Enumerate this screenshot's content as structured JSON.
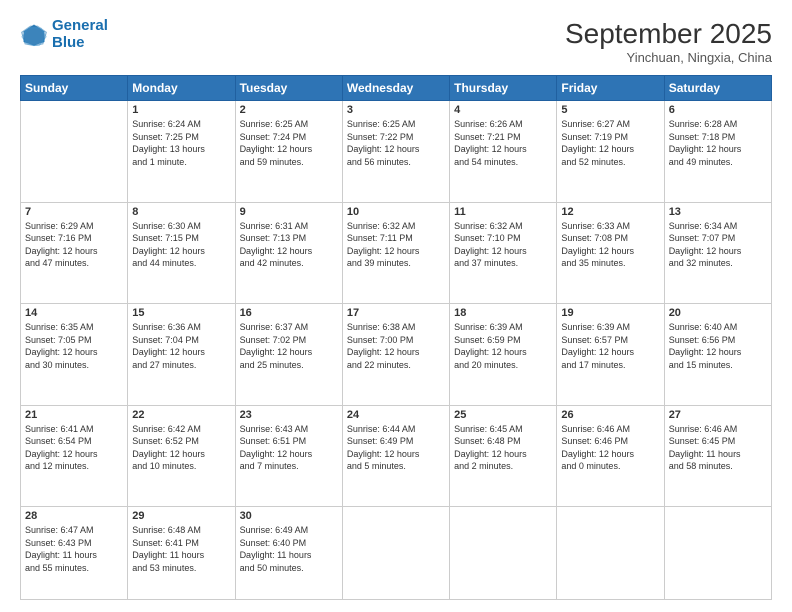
{
  "logo": {
    "line1": "General",
    "line2": "Blue"
  },
  "header": {
    "month_year": "September 2025",
    "location": "Yinchuan, Ningxia, China"
  },
  "weekdays": [
    "Sunday",
    "Monday",
    "Tuesday",
    "Wednesday",
    "Thursday",
    "Friday",
    "Saturday"
  ],
  "weeks": [
    [
      {
        "day": "",
        "info": ""
      },
      {
        "day": "1",
        "info": "Sunrise: 6:24 AM\nSunset: 7:25 PM\nDaylight: 13 hours\nand 1 minute."
      },
      {
        "day": "2",
        "info": "Sunrise: 6:25 AM\nSunset: 7:24 PM\nDaylight: 12 hours\nand 59 minutes."
      },
      {
        "day": "3",
        "info": "Sunrise: 6:25 AM\nSunset: 7:22 PM\nDaylight: 12 hours\nand 56 minutes."
      },
      {
        "day": "4",
        "info": "Sunrise: 6:26 AM\nSunset: 7:21 PM\nDaylight: 12 hours\nand 54 minutes."
      },
      {
        "day": "5",
        "info": "Sunrise: 6:27 AM\nSunset: 7:19 PM\nDaylight: 12 hours\nand 52 minutes."
      },
      {
        "day": "6",
        "info": "Sunrise: 6:28 AM\nSunset: 7:18 PM\nDaylight: 12 hours\nand 49 minutes."
      }
    ],
    [
      {
        "day": "7",
        "info": "Sunrise: 6:29 AM\nSunset: 7:16 PM\nDaylight: 12 hours\nand 47 minutes."
      },
      {
        "day": "8",
        "info": "Sunrise: 6:30 AM\nSunset: 7:15 PM\nDaylight: 12 hours\nand 44 minutes."
      },
      {
        "day": "9",
        "info": "Sunrise: 6:31 AM\nSunset: 7:13 PM\nDaylight: 12 hours\nand 42 minutes."
      },
      {
        "day": "10",
        "info": "Sunrise: 6:32 AM\nSunset: 7:11 PM\nDaylight: 12 hours\nand 39 minutes."
      },
      {
        "day": "11",
        "info": "Sunrise: 6:32 AM\nSunset: 7:10 PM\nDaylight: 12 hours\nand 37 minutes."
      },
      {
        "day": "12",
        "info": "Sunrise: 6:33 AM\nSunset: 7:08 PM\nDaylight: 12 hours\nand 35 minutes."
      },
      {
        "day": "13",
        "info": "Sunrise: 6:34 AM\nSunset: 7:07 PM\nDaylight: 12 hours\nand 32 minutes."
      }
    ],
    [
      {
        "day": "14",
        "info": "Sunrise: 6:35 AM\nSunset: 7:05 PM\nDaylight: 12 hours\nand 30 minutes."
      },
      {
        "day": "15",
        "info": "Sunrise: 6:36 AM\nSunset: 7:04 PM\nDaylight: 12 hours\nand 27 minutes."
      },
      {
        "day": "16",
        "info": "Sunrise: 6:37 AM\nSunset: 7:02 PM\nDaylight: 12 hours\nand 25 minutes."
      },
      {
        "day": "17",
        "info": "Sunrise: 6:38 AM\nSunset: 7:00 PM\nDaylight: 12 hours\nand 22 minutes."
      },
      {
        "day": "18",
        "info": "Sunrise: 6:39 AM\nSunset: 6:59 PM\nDaylight: 12 hours\nand 20 minutes."
      },
      {
        "day": "19",
        "info": "Sunrise: 6:39 AM\nSunset: 6:57 PM\nDaylight: 12 hours\nand 17 minutes."
      },
      {
        "day": "20",
        "info": "Sunrise: 6:40 AM\nSunset: 6:56 PM\nDaylight: 12 hours\nand 15 minutes."
      }
    ],
    [
      {
        "day": "21",
        "info": "Sunrise: 6:41 AM\nSunset: 6:54 PM\nDaylight: 12 hours\nand 12 minutes."
      },
      {
        "day": "22",
        "info": "Sunrise: 6:42 AM\nSunset: 6:52 PM\nDaylight: 12 hours\nand 10 minutes."
      },
      {
        "day": "23",
        "info": "Sunrise: 6:43 AM\nSunset: 6:51 PM\nDaylight: 12 hours\nand 7 minutes."
      },
      {
        "day": "24",
        "info": "Sunrise: 6:44 AM\nSunset: 6:49 PM\nDaylight: 12 hours\nand 5 minutes."
      },
      {
        "day": "25",
        "info": "Sunrise: 6:45 AM\nSunset: 6:48 PM\nDaylight: 12 hours\nand 2 minutes."
      },
      {
        "day": "26",
        "info": "Sunrise: 6:46 AM\nSunset: 6:46 PM\nDaylight: 12 hours\nand 0 minutes."
      },
      {
        "day": "27",
        "info": "Sunrise: 6:46 AM\nSunset: 6:45 PM\nDaylight: 11 hours\nand 58 minutes."
      }
    ],
    [
      {
        "day": "28",
        "info": "Sunrise: 6:47 AM\nSunset: 6:43 PM\nDaylight: 11 hours\nand 55 minutes."
      },
      {
        "day": "29",
        "info": "Sunrise: 6:48 AM\nSunset: 6:41 PM\nDaylight: 11 hours\nand 53 minutes."
      },
      {
        "day": "30",
        "info": "Sunrise: 6:49 AM\nSunset: 6:40 PM\nDaylight: 11 hours\nand 50 minutes."
      },
      {
        "day": "",
        "info": ""
      },
      {
        "day": "",
        "info": ""
      },
      {
        "day": "",
        "info": ""
      },
      {
        "day": "",
        "info": ""
      }
    ]
  ]
}
